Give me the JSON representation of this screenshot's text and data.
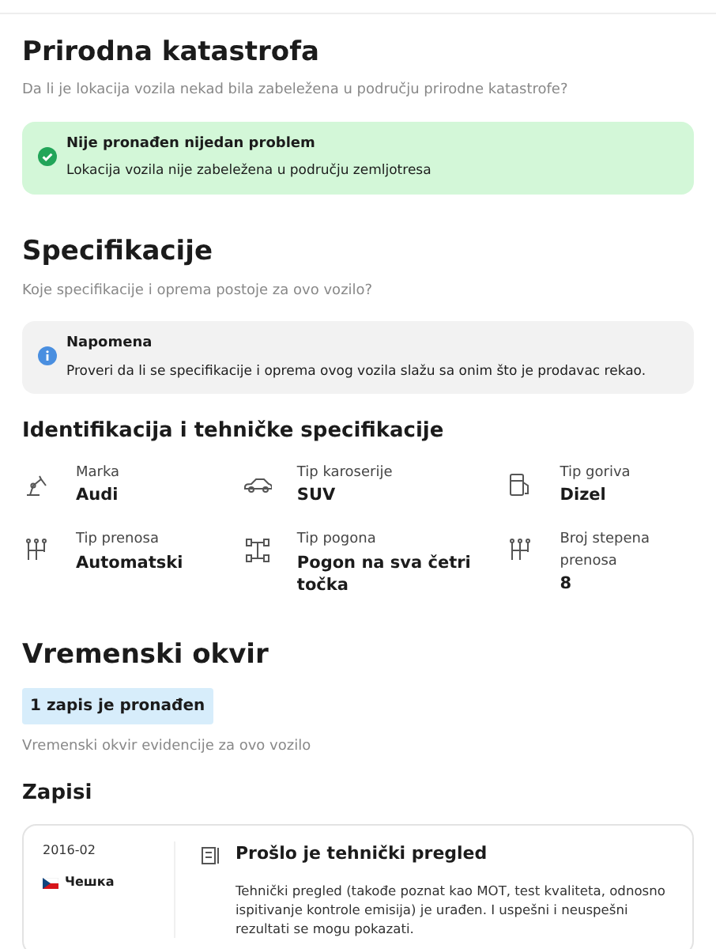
{
  "sections": [
    {
      "title": "Prirodna katastrofa",
      "subtitle": "Da li je lokacija vozila nekad bila zabeležena u području prirodne katastrofe?",
      "alert": {
        "kind": "success",
        "title": "Nije pronađen nijedan problem",
        "text": "Lokacija vozila nije zabeležena u području zemljotresa"
      }
    },
    {
      "title": "Specifikacije",
      "subtitle": "Koje specifikacije i oprema postoje za ovo vozilo?",
      "alert": {
        "kind": "info",
        "title": "Napomena",
        "text": "Proveri da li se specifikacije i oprema ovog vozila slažu sa onim što je prodavac rekao."
      },
      "subsection": "Identifikacija i tehničke specifikacije",
      "specs": [
        {
          "kind": "make",
          "label": "Marka",
          "value": "Audi"
        },
        {
          "kind": "body",
          "label": "Tip karoserije",
          "value": "SUV"
        },
        {
          "kind": "fuel",
          "label": "Tip goriva",
          "value": "Dizel"
        },
        {
          "kind": "gearbox",
          "label": "Tip prenosa",
          "value": "Automatski"
        },
        {
          "kind": "drive",
          "label": "Tip pogona",
          "value": "Pogon na sva četri točka"
        },
        {
          "kind": "gearbox",
          "label": "Broj stepena prenosa",
          "value": "8"
        }
      ]
    },
    {
      "title": "Vremenski okvir",
      "badge": "1 zapis je pronađen",
      "subtitle": "Vremenski okvir evidencije za ovo vozilo",
      "subsection": "Zapisi",
      "records": [
        {
          "date": "2016-02",
          "country": "Чешка",
          "title": "Prošlo je tehnički pregled",
          "text": "Tehnički pregled (takođe poznat kao MOT, test kvaliteta, odnosno ispitivanje kontrole emisija) je urađen. I uspešni i neuspešni rezultati se mogu pokazati."
        }
      ]
    }
  ]
}
